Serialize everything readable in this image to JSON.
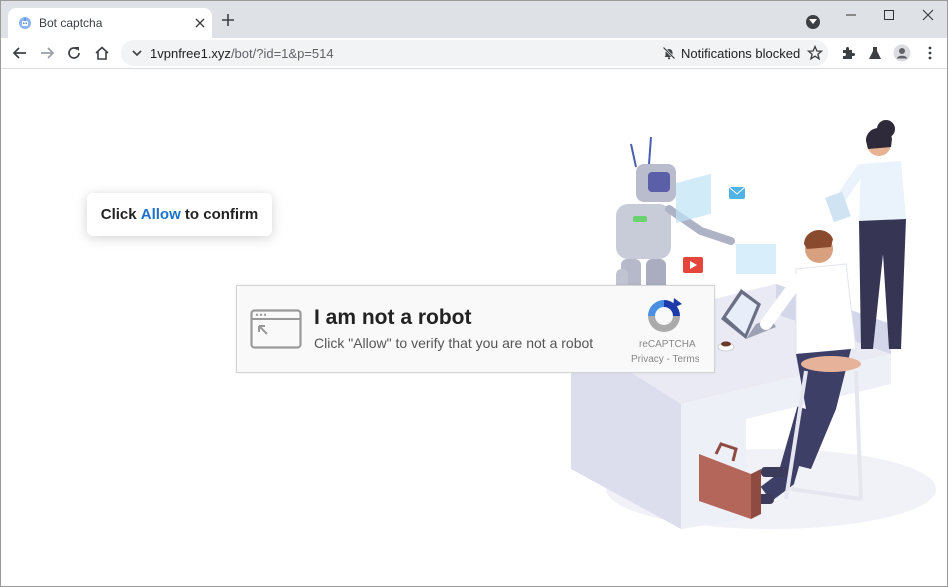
{
  "browser": {
    "tab": {
      "title": "Bot captcha"
    },
    "url": {
      "domain": "1vpnfree1.xyz",
      "path": "/bot/?id=1&p=514"
    },
    "notification_status": "Notifications blocked"
  },
  "page": {
    "bubble": {
      "prefix": "Click ",
      "highlight": "Allow",
      "suffix": " to confirm"
    },
    "captcha": {
      "title": "I am not a robot",
      "subtitle": "Click \"Allow\" to verify that you are not a robot",
      "brand": "reCAPTCHA",
      "links": "Privacy - Terms"
    }
  },
  "colors": {
    "accent": "#1a73c8",
    "tabstrip": "#dee1e6"
  }
}
